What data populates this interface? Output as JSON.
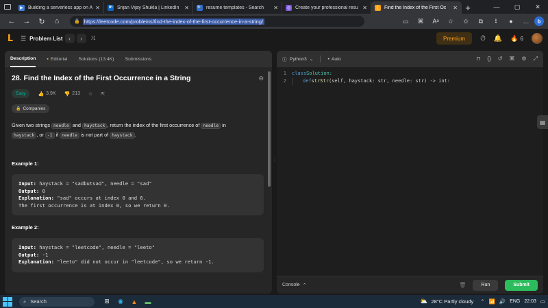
{
  "browser": {
    "tabs": [
      {
        "title": "Building a serverless app on A",
        "fav_color": "#3b7ddd",
        "fav_glyph": "▶",
        "active": false
      },
      {
        "title": "Srijan Vijay Shukla | LinkedIn",
        "fav_color": "#0a66c2",
        "fav_glyph": "in",
        "active": false
      },
      {
        "title": "resume templates - Search",
        "fav_color": "#2b6fd6",
        "fav_glyph": "🔍",
        "active": false
      },
      {
        "title": "Create your professional resu",
        "fav_color": "#7b5bd6",
        "fav_glyph": "◎",
        "active": false
      },
      {
        "title": "Find the Index of the First Oc",
        "fav_color": "#ffa116",
        "fav_glyph": "⟨",
        "active": true
      }
    ],
    "new_tab": "+",
    "window_controls": [
      "—",
      "▢",
      "✕"
    ],
    "url": "https://leetcode.com/problems/find-the-index-of-the-first-occurrence-in-a-string/"
  },
  "lc_nav": {
    "problem_list": "Problem List",
    "premium": "Premium",
    "streak_count": "6"
  },
  "left": {
    "tabs": [
      {
        "label": "Description",
        "icon": "",
        "active": true
      },
      {
        "label": "Editorial",
        "icon": "editorial-icon",
        "active": false
      },
      {
        "label": "Solutions (13.4K)",
        "icon": "solutions-icon",
        "active": false
      },
      {
        "label": "Submissions",
        "icon": "submissions-icon",
        "active": false
      }
    ],
    "title": "28. Find the Index of the First Occurrence in a String",
    "difficulty": "Easy",
    "likes": "3.9K",
    "dislikes": "213",
    "companies": "Companies",
    "description": {
      "p1": "Given two strings ",
      "c1": "needle",
      "p2": " and ",
      "c2": "haystack",
      "p3": ", return the index of the first occurrence of ",
      "c3": "needle",
      "p4": " in ",
      "c4": "haystack",
      "p5": ", or ",
      "c5": "-1",
      "p6": " if ",
      "c6": "needle",
      "p7": " is not part of ",
      "c7": "haystack",
      "p8": "."
    },
    "examples": [
      {
        "label": "Example 1:",
        "input_label": "Input:",
        "input": " haystack = \"sadbutsad\", needle = \"sad\"",
        "output_label": "Output:",
        "output": " 0",
        "expl_label": "Explanation:",
        "expl": " \"sad\" occurs at index 0 and 6.",
        "expl2": "The first occurrence is at index 0, so we return 0."
      },
      {
        "label": "Example 2:",
        "input_label": "Input:",
        "input": " haystack = \"leetcode\", needle = \"leeto\"",
        "output_label": "Output:",
        "output": " -1",
        "expl_label": "Explanation:",
        "expl": " \"leeto\" did not occur in \"leetcode\", so we return -1."
      }
    ]
  },
  "right": {
    "language": "Python3",
    "auto": "Auto",
    "code": {
      "l1_no": "1",
      "l1_kw": "class",
      "l1_cls": " Solution:",
      "l2_no": "2",
      "l2_kw": "def",
      "l2_fn": " strStr",
      "l2_rest": "(self, haystack: str, needle: str) -> int:"
    },
    "console": "Console",
    "run": "Run",
    "submit": "Submit"
  },
  "taskbar": {
    "search": "Search",
    "weather": "28°C  Partly cloudy",
    "lang": "ENG",
    "time": "22:03"
  }
}
